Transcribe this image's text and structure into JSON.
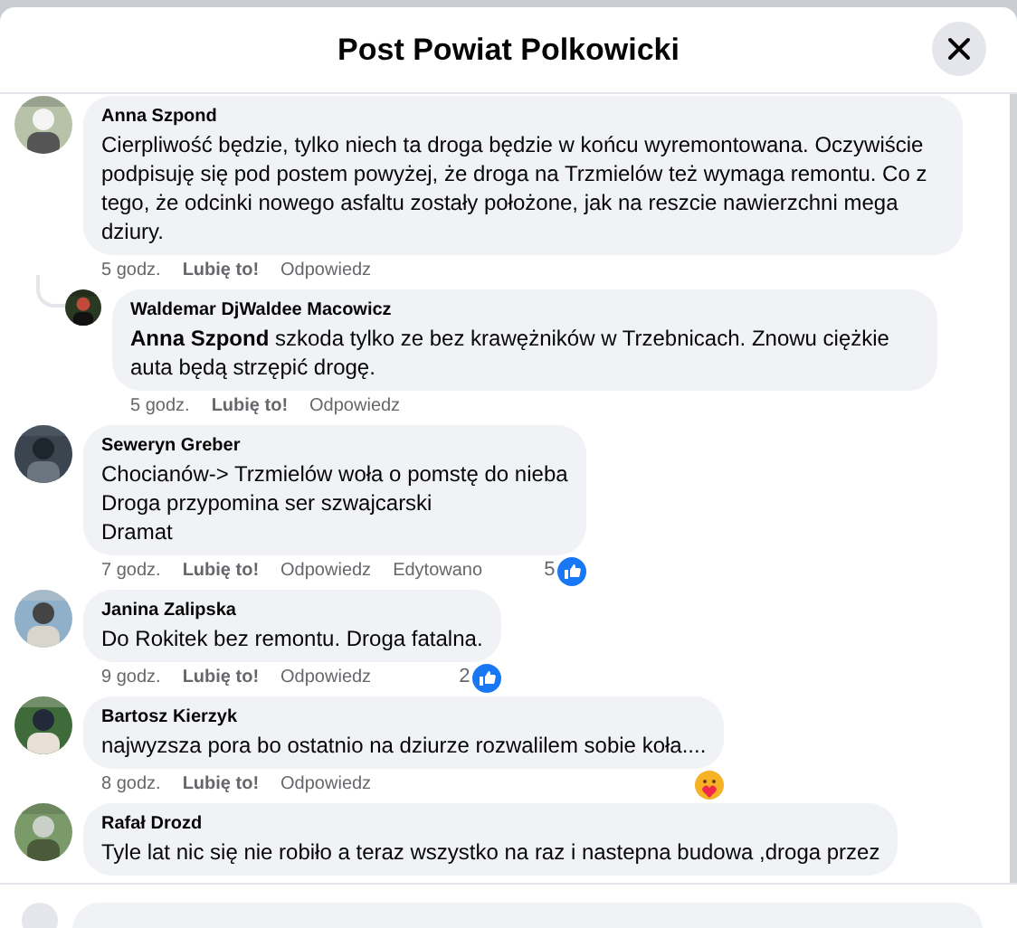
{
  "dialog": {
    "title": "Post Powiat Polkowicki"
  },
  "comments": [
    {
      "name": "Anna Szpond",
      "text": "Cierpliwość będzie, tylko niech ta droga będzie w końcu wyremontowana. Oczywiście podpisuję się pod postem powyżej, że droga na Trzmielów też wymaga remontu. Co z tego, że odcinki nowego asfaltu zostały położone, jak na reszcie nawierzchni mega dziury.",
      "time": "5 godz.",
      "like": "Lubię to!",
      "reply": "Odpowiedz",
      "children": [
        {
          "name": "Waldemar DjWaldee Macowicz",
          "text": "**Anna Szpond** szkoda tylko ze bez krawężników w Trzebnicach. Znowu ciężkie auta będą strzępić drogę.",
          "time": "5 godz.",
          "like": "Lubię to!",
          "reply": "Odpowiedz"
        }
      ]
    },
    {
      "name": "Seweryn Greber",
      "lines": [
        "Chocianów-> Trzmielów woła o pomstę do nieba",
        "Droga przypomina ser szwajcarski",
        "Dramat"
      ],
      "time": "7 godz.",
      "like": "Lubię to!",
      "reply": "Odpowiedz",
      "edited": "Edytowano",
      "reaction": {
        "kind": "like",
        "count": "5"
      }
    },
    {
      "name": "Janina Zalipska",
      "text": "Do Rokitek bez remontu. Droga fatalna.",
      "time": "9 godz.",
      "like": "Lubię to!",
      "reply": "Odpowiedz",
      "reaction": {
        "kind": "like",
        "count": "2"
      }
    },
    {
      "name": "Bartosz Kierzyk",
      "text": "najwyzsza pora bo ostatnio na dziurze rozwalilem sobie koła....",
      "time": "8 godz.",
      "like": "Lubię to!",
      "reply": "Odpowiedz",
      "reaction": {
        "kind": "care"
      }
    },
    {
      "name": "Rafał Drozd",
      "text": "Tyle lat nic się nie robiło a teraz wszystko na raz i nastepna budowa ,droga przez"
    }
  ]
}
